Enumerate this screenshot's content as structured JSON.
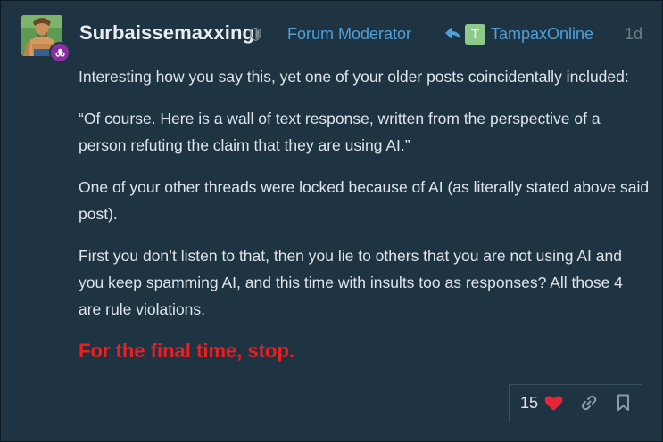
{
  "post": {
    "username": "Surbaissemaxxing",
    "user_title": "Forum Moderator",
    "reply_to": {
      "avatar_letter": "T",
      "username": "TampaxOnline"
    },
    "date": "1d",
    "paragraphs": [
      "Interesting how you say this, yet one of your older posts coincidentally included:",
      "“Of course. Here is a wall of text response, written from the perspective of a person refuting the claim that they are using AI.”",
      "One of your other threads were locked because of AI (as literally stated above said post).",
      "First you don’t listen to that, then you lie to others that you are not using AI and you keep spamming AI, and this time with insults too as responses? All those 4 are rule violations."
    ],
    "warning": "For the final time, stop.",
    "like_count": "15"
  },
  "colors": {
    "background": "#1f3443",
    "link": "#4f9fd9",
    "warning": "#ef1d1d",
    "heart": "#e8233a",
    "flair": "#8a2ea0",
    "reply_avatar": "#8fc989"
  },
  "icons": {
    "shield": "shield-icon",
    "reply": "reply-arrow-icon",
    "heart": "heart-icon",
    "link": "link-icon",
    "bookmark": "bookmark-icon",
    "flair": "moderator-flair-icon"
  }
}
